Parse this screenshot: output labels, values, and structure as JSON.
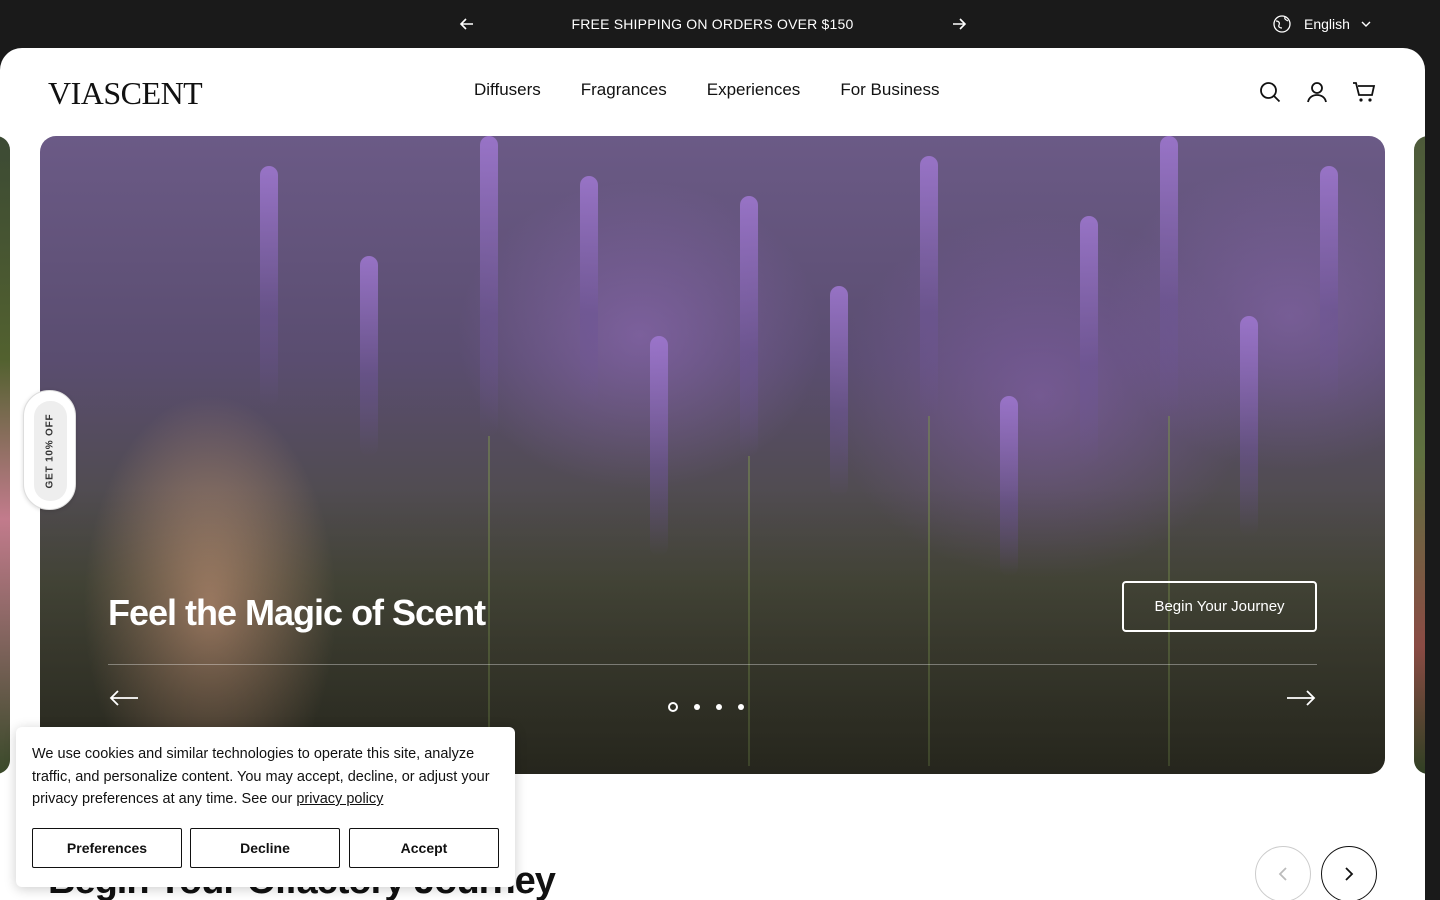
{
  "announcement": {
    "message": "FREE SHIPPING ON ORDERS OVER $150",
    "prev_icon": "arrow-left-icon",
    "next_icon": "arrow-right-icon"
  },
  "language": {
    "label": "English",
    "icon": "globe-icon"
  },
  "header": {
    "logo": "VIASCENT",
    "nav": [
      "Diffusers",
      "Fragrances",
      "Experiences",
      "For Business"
    ],
    "icons": [
      "search-icon",
      "account-icon",
      "cart-icon"
    ]
  },
  "hero": {
    "title": "Feel the Magic of Scent",
    "cta_label": "Begin Your Journey",
    "slide_count": 4,
    "active_slide": 1
  },
  "discount_tab": {
    "label": "GET 10% OFF"
  },
  "section": {
    "title": "Begin Your Olfactory Journey"
  },
  "cookie": {
    "text": "We use cookies and similar technologies to operate this site, analyze traffic, and personalize content. You may accept, decline, or adjust your privacy preferences at any time. See our",
    "link": "privacy policy",
    "buttons": {
      "preferences": "Preferences",
      "decline": "Decline",
      "accept": "Accept"
    }
  }
}
